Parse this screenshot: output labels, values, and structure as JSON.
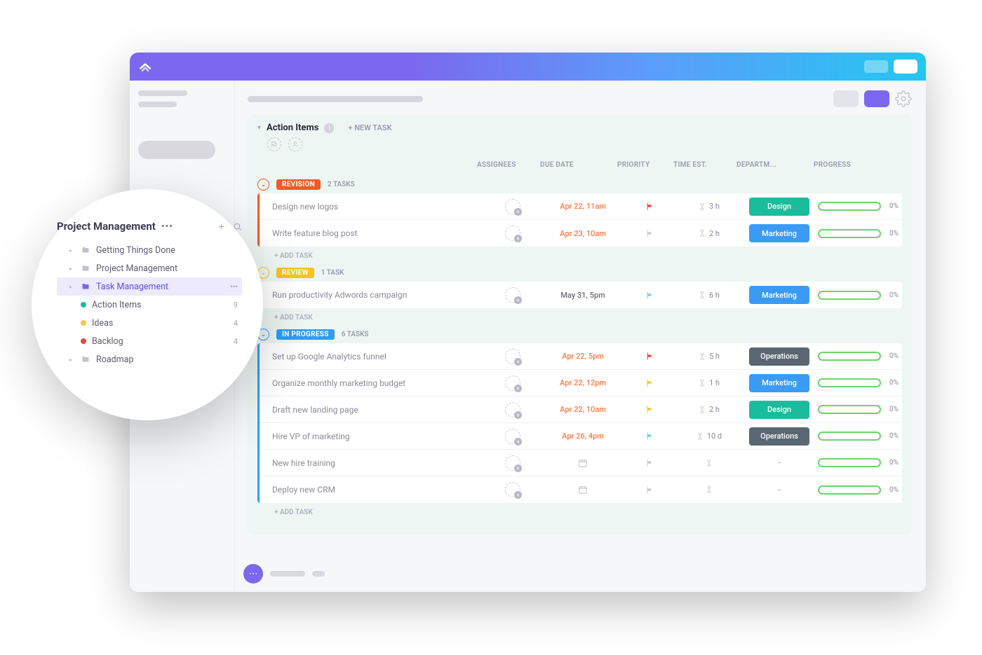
{
  "board": {
    "title": "Action Items",
    "new_task": "+ NEW TASK",
    "add_task": "+ ADD TASK",
    "columns": [
      "ASSIGNEES",
      "DUE DATE",
      "PRIORITY",
      "TIME EST.",
      "DEPARTM...",
      "PROGRESS"
    ]
  },
  "groups": [
    {
      "id": "revision",
      "label": "REVISION",
      "color": "#f05a28",
      "count": "2 TASKS",
      "tasks": [
        {
          "title": "Design new logos",
          "due": "Apr 22, 11am",
          "due_style": "orange",
          "flag": "red",
          "est": "3 h",
          "dept": "Design",
          "dept_class": "design",
          "progress": "0%"
        },
        {
          "title": "Write feature blog post",
          "due": "Apr 23, 10am",
          "due_style": "orange",
          "flag": "gray",
          "est": "2 h",
          "dept": "Marketing",
          "dept_class": "marketing",
          "progress": "0%"
        }
      ]
    },
    {
      "id": "review",
      "label": "REVIEW",
      "color": "#f5c518",
      "count": "1 TASK",
      "tasks": [
        {
          "title": "Run productivity Adwords campaign",
          "due": "May 31, 5pm",
          "due_style": "gray",
          "flag": "sky",
          "est": "6 h",
          "dept": "Marketing",
          "dept_class": "marketing",
          "progress": "0%"
        }
      ]
    },
    {
      "id": "inprogress",
      "label": "IN PROGRESS",
      "color": "#2E9DF7",
      "count": "6 TASKS",
      "tasks": [
        {
          "title": "Set up Google Analytics funnel",
          "due": "Apr 22, 5pm",
          "due_style": "orange",
          "flag": "red",
          "est": "5 h",
          "dept": "Operations",
          "dept_class": "operations",
          "progress": "0%"
        },
        {
          "title": "Organize monthly marketing budget",
          "due": "Apr 22, 12pm",
          "due_style": "orange",
          "flag": "yellow",
          "est": "1 h",
          "dept": "Marketing",
          "dept_class": "marketing",
          "progress": "0%"
        },
        {
          "title": "Draft new landing page",
          "due": "Apr 22, 10am",
          "due_style": "orange",
          "flag": "yellow",
          "est": "2 h",
          "dept": "Design",
          "dept_class": "design",
          "progress": "0%"
        },
        {
          "title": "Hire VP of marketing",
          "due": "Apr 26, 4pm",
          "due_style": "orange",
          "flag": "sky",
          "est": "10 d",
          "dept": "Operations",
          "dept_class": "operations",
          "progress": "0%"
        },
        {
          "title": "New hire training",
          "due": "",
          "due_style": "cal",
          "flag": "gray",
          "est": "",
          "dept": "-",
          "dept_class": "none",
          "progress": "0%"
        },
        {
          "title": "Deploy new CRM",
          "due": "",
          "due_style": "cal",
          "flag": "gray",
          "est": "",
          "dept": "-",
          "dept_class": "none",
          "progress": "0%"
        }
      ]
    }
  ],
  "lens": {
    "title": "Project Management",
    "items": [
      {
        "type": "folder",
        "label": "Getting Things Done",
        "indent": 1
      },
      {
        "type": "folder",
        "label": "Project Management",
        "indent": 1
      },
      {
        "type": "folder",
        "label": "Task Management",
        "indent": 1,
        "selected": true,
        "trail": "•••"
      },
      {
        "type": "list",
        "label": "Action Items",
        "indent": 2,
        "dot": "g",
        "count": "9"
      },
      {
        "type": "list",
        "label": "Ideas",
        "indent": 2,
        "dot": "y",
        "count": "4"
      },
      {
        "type": "list",
        "label": "Backlog",
        "indent": 2,
        "dot": "r",
        "count": "4"
      },
      {
        "type": "folder",
        "label": "Roadmap",
        "indent": 1
      }
    ]
  }
}
